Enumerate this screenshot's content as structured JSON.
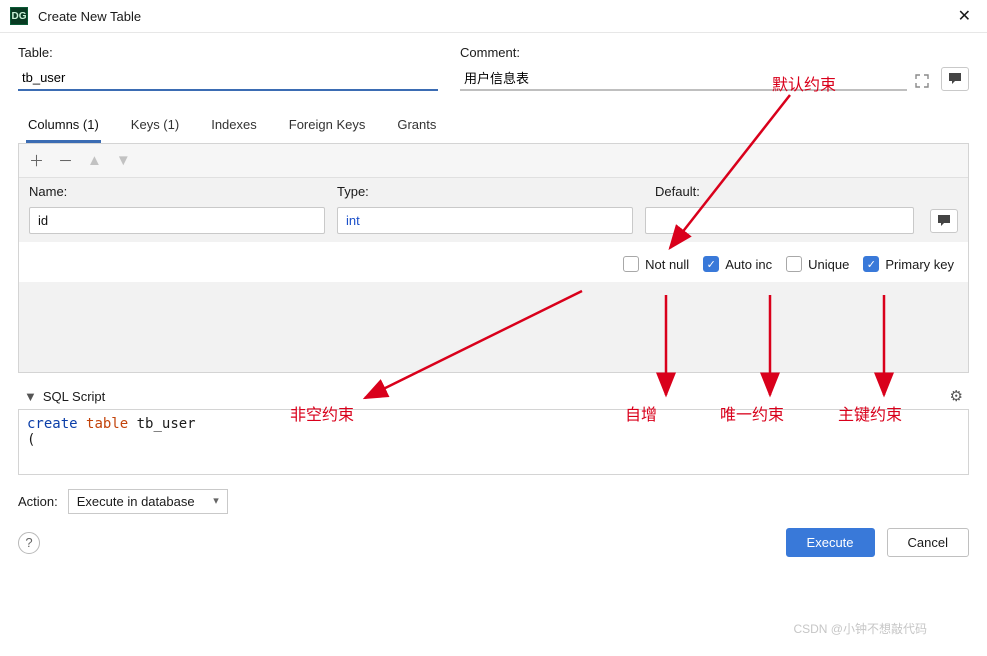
{
  "window": {
    "title": "Create New Table",
    "app_icon_text": "DG",
    "close_glyph": "✕"
  },
  "labels": {
    "table": "Table:",
    "comment": "Comment:",
    "name": "Name:",
    "type": "Type:",
    "default": "Default:",
    "sql_script": "SQL Script",
    "action": "Action:"
  },
  "fields": {
    "table_name": "tb_user",
    "comment_value": "用户信息表",
    "col_name": "id",
    "col_type": "int",
    "col_default": "",
    "action_selected": "Execute in database"
  },
  "tabs": [
    {
      "label": "Columns (1)",
      "active": true
    },
    {
      "label": "Keys (1)",
      "active": false
    },
    {
      "label": "Indexes",
      "active": false
    },
    {
      "label": "Foreign Keys",
      "active": false
    },
    {
      "label": "Grants",
      "active": false
    }
  ],
  "checks": {
    "not_null": {
      "label": "Not null",
      "checked": false
    },
    "auto_inc": {
      "label": "Auto inc",
      "checked": true
    },
    "unique": {
      "label": "Unique",
      "checked": false
    },
    "primary_key": {
      "label": "Primary key",
      "checked": true
    }
  },
  "script": {
    "kw_create": "create",
    "kw_table": "table",
    "ident": "tb_user",
    "paren": "("
  },
  "buttons": {
    "execute": "Execute",
    "cancel": "Cancel"
  },
  "annotations": {
    "default_constraint": "默认约束",
    "not_null_constraint": "非空约束",
    "auto_inc_label": "自增",
    "unique_constraint": "唯一约束",
    "primary_key_constraint": "主键约束"
  },
  "watermark": "CSDN @小钟不想敲代码"
}
